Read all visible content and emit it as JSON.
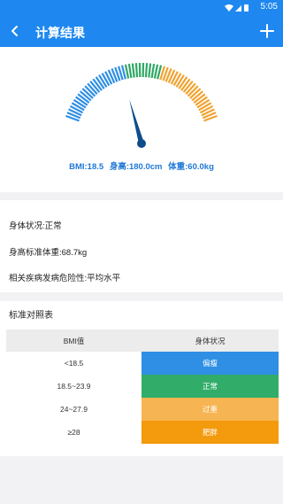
{
  "status_bar": {
    "time": "5:05",
    "icons": [
      "wifi-icon",
      "signal-icon",
      "battery-icon"
    ]
  },
  "app_bar": {
    "title": "计算结果",
    "back_icon": "arrow-left-icon",
    "add_icon": "plus-icon"
  },
  "gauge": {
    "bmi_text": "BMI:18.5",
    "height_text": "身高:180.0cm",
    "weight_text": "体重:60.0kg",
    "needle_value": 0.39,
    "segments": [
      {
        "color": "#2f8fe4",
        "fraction": 0.4
      },
      {
        "color": "#2fa865",
        "fraction": 0.2
      },
      {
        "color": "#f0a332",
        "fraction": 0.4
      }
    ]
  },
  "info": {
    "condition": "身体状况:正常",
    "standard_weight": "身高标准体重:68.7kg",
    "risk": "相关疾病发病危险性:平均水平"
  },
  "table": {
    "title": "标准对照表",
    "headers": [
      "BMI值",
      "身体状况"
    ],
    "rows": [
      {
        "range": "<18.5",
        "status": "偏瘦",
        "color": "#2f8fe4"
      },
      {
        "range": "18.5~23.9",
        "status": "正常",
        "color": "#31ad69"
      },
      {
        "range": "24~27.9",
        "status": "过重",
        "color": "#f7b452"
      },
      {
        "range": "≥28",
        "status": "肥胖",
        "color": "#f39a0d"
      }
    ]
  }
}
